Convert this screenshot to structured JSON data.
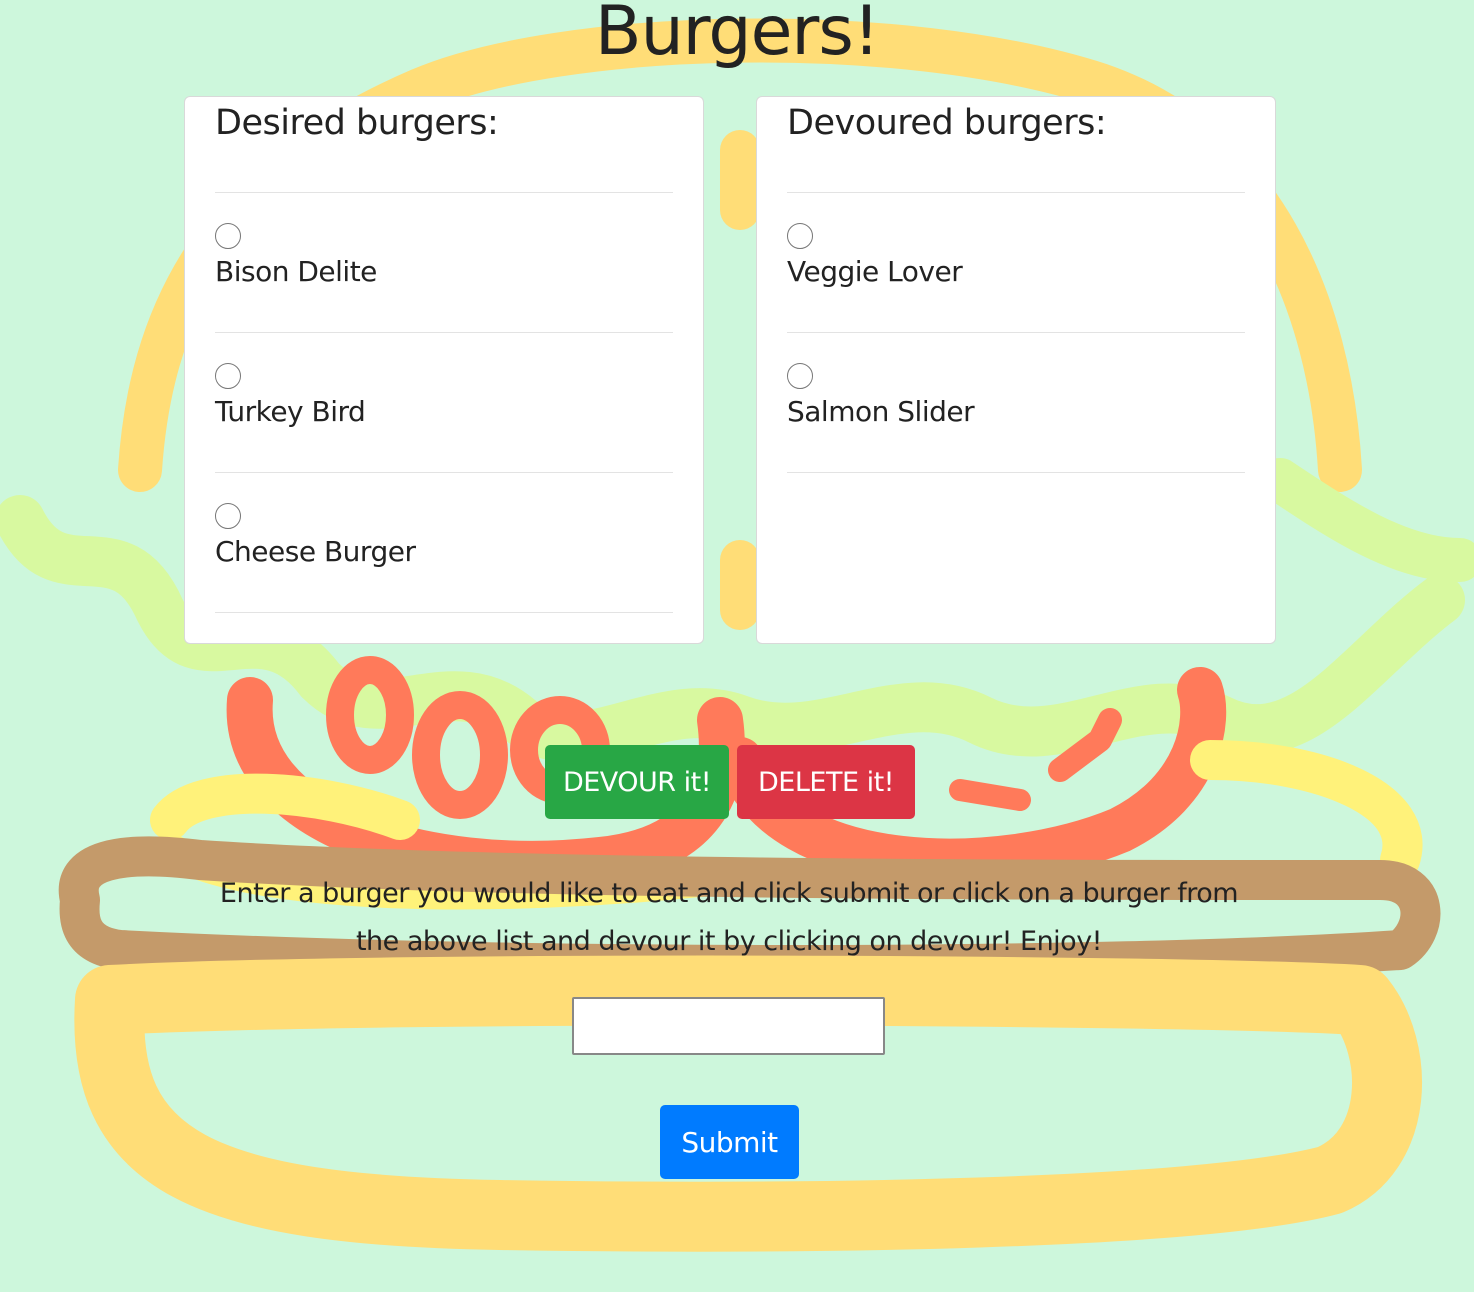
{
  "page": {
    "title": "Burgers!"
  },
  "desired": {
    "title": "Desired burgers:",
    "items": [
      {
        "name": "Bison Delite"
      },
      {
        "name": "Turkey Bird"
      },
      {
        "name": "Cheese Burger"
      }
    ]
  },
  "devoured": {
    "title": "Devoured burgers:",
    "items": [
      {
        "name": "Veggie Lover"
      },
      {
        "name": "Salmon Slider"
      }
    ]
  },
  "actions": {
    "devour_label": "DEVOUR it!",
    "delete_label": "DELETE it!"
  },
  "form": {
    "instructions": "Enter a burger you would like to eat and click submit or click on a burger from the above list and devour it by clicking on devour! Enjoy!",
    "input_value": "",
    "submit_label": "Submit"
  },
  "colors": {
    "background": "#cdf7dc",
    "bun": "#ffdd77",
    "lettuce": "#d8f9a0",
    "tomato": "#ff7a5a",
    "cheese": "#fff27a",
    "patty": "#c49a6a",
    "devour_button": "#28a745",
    "delete_button": "#dc3545",
    "submit_button": "#007bff"
  }
}
